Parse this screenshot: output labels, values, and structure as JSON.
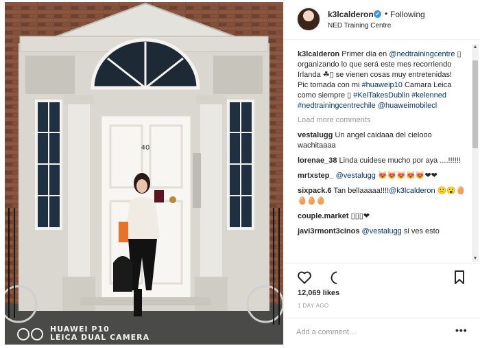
{
  "photo": {
    "door_number": "40",
    "watermark_line1": "HUAWEI P10",
    "watermark_line2": "LEICA DUAL CAMERA"
  },
  "header": {
    "username": "k3lcalderon",
    "verified_symbol": "✔",
    "separator": "•",
    "follow_label": "Following",
    "location": "NED Training Centre"
  },
  "caption": {
    "username": "k3lcalderon",
    "parts": [
      "Primer día en",
      "@nedtrainingcentre",
      "▯ organizando lo que será este mes recorriendo Irlanda ☘▯ se vienen cosas muy entretenidas!",
      "Pic tomada con mi",
      "#huaweip10",
      "Camara Leica como siempre ▯",
      "#KelTakesDublin",
      "#kelenned",
      "#nedtrainingcentrechile",
      "@huaweimobilecl"
    ]
  },
  "load_more_label": "Load more comments",
  "comments": [
    {
      "user": "vestalugg",
      "text": "Un angel caidaaa del cielooo wachitaaaa",
      "mention": ""
    },
    {
      "user": "lorenae_38",
      "text": "Linda cuidese mucho por aya ....!!!!!!",
      "mention": ""
    },
    {
      "user": "mrtxstep_",
      "text": "😻😻😻😻😻❤❤",
      "mention": "@vestalugg"
    },
    {
      "user": "sixpack.6",
      "text": "Tan bellaaaaa!!!!",
      "mention": "@k3lcalderon",
      "tail": "🙂😮🥚🥚🥚🥚"
    },
    {
      "user": "couple.market",
      "text": "▯▯▯❤",
      "mention": ""
    },
    {
      "user": "javi3rmont3cinos",
      "text": "si ves esto",
      "mention": "@vestalugg"
    }
  ],
  "actions": {
    "like_icon": "heart-icon",
    "comment_icon": "speech-bubble-icon",
    "save_icon": "bookmark-icon",
    "likes": "12,069 likes",
    "time": "1 DAY AGO"
  },
  "add_comment": {
    "placeholder": "Add a comment...",
    "more_label": "•••"
  },
  "colors": {
    "link": "#003569",
    "verified": "#3897f0",
    "muted": "#999999",
    "border": "#efefef"
  }
}
